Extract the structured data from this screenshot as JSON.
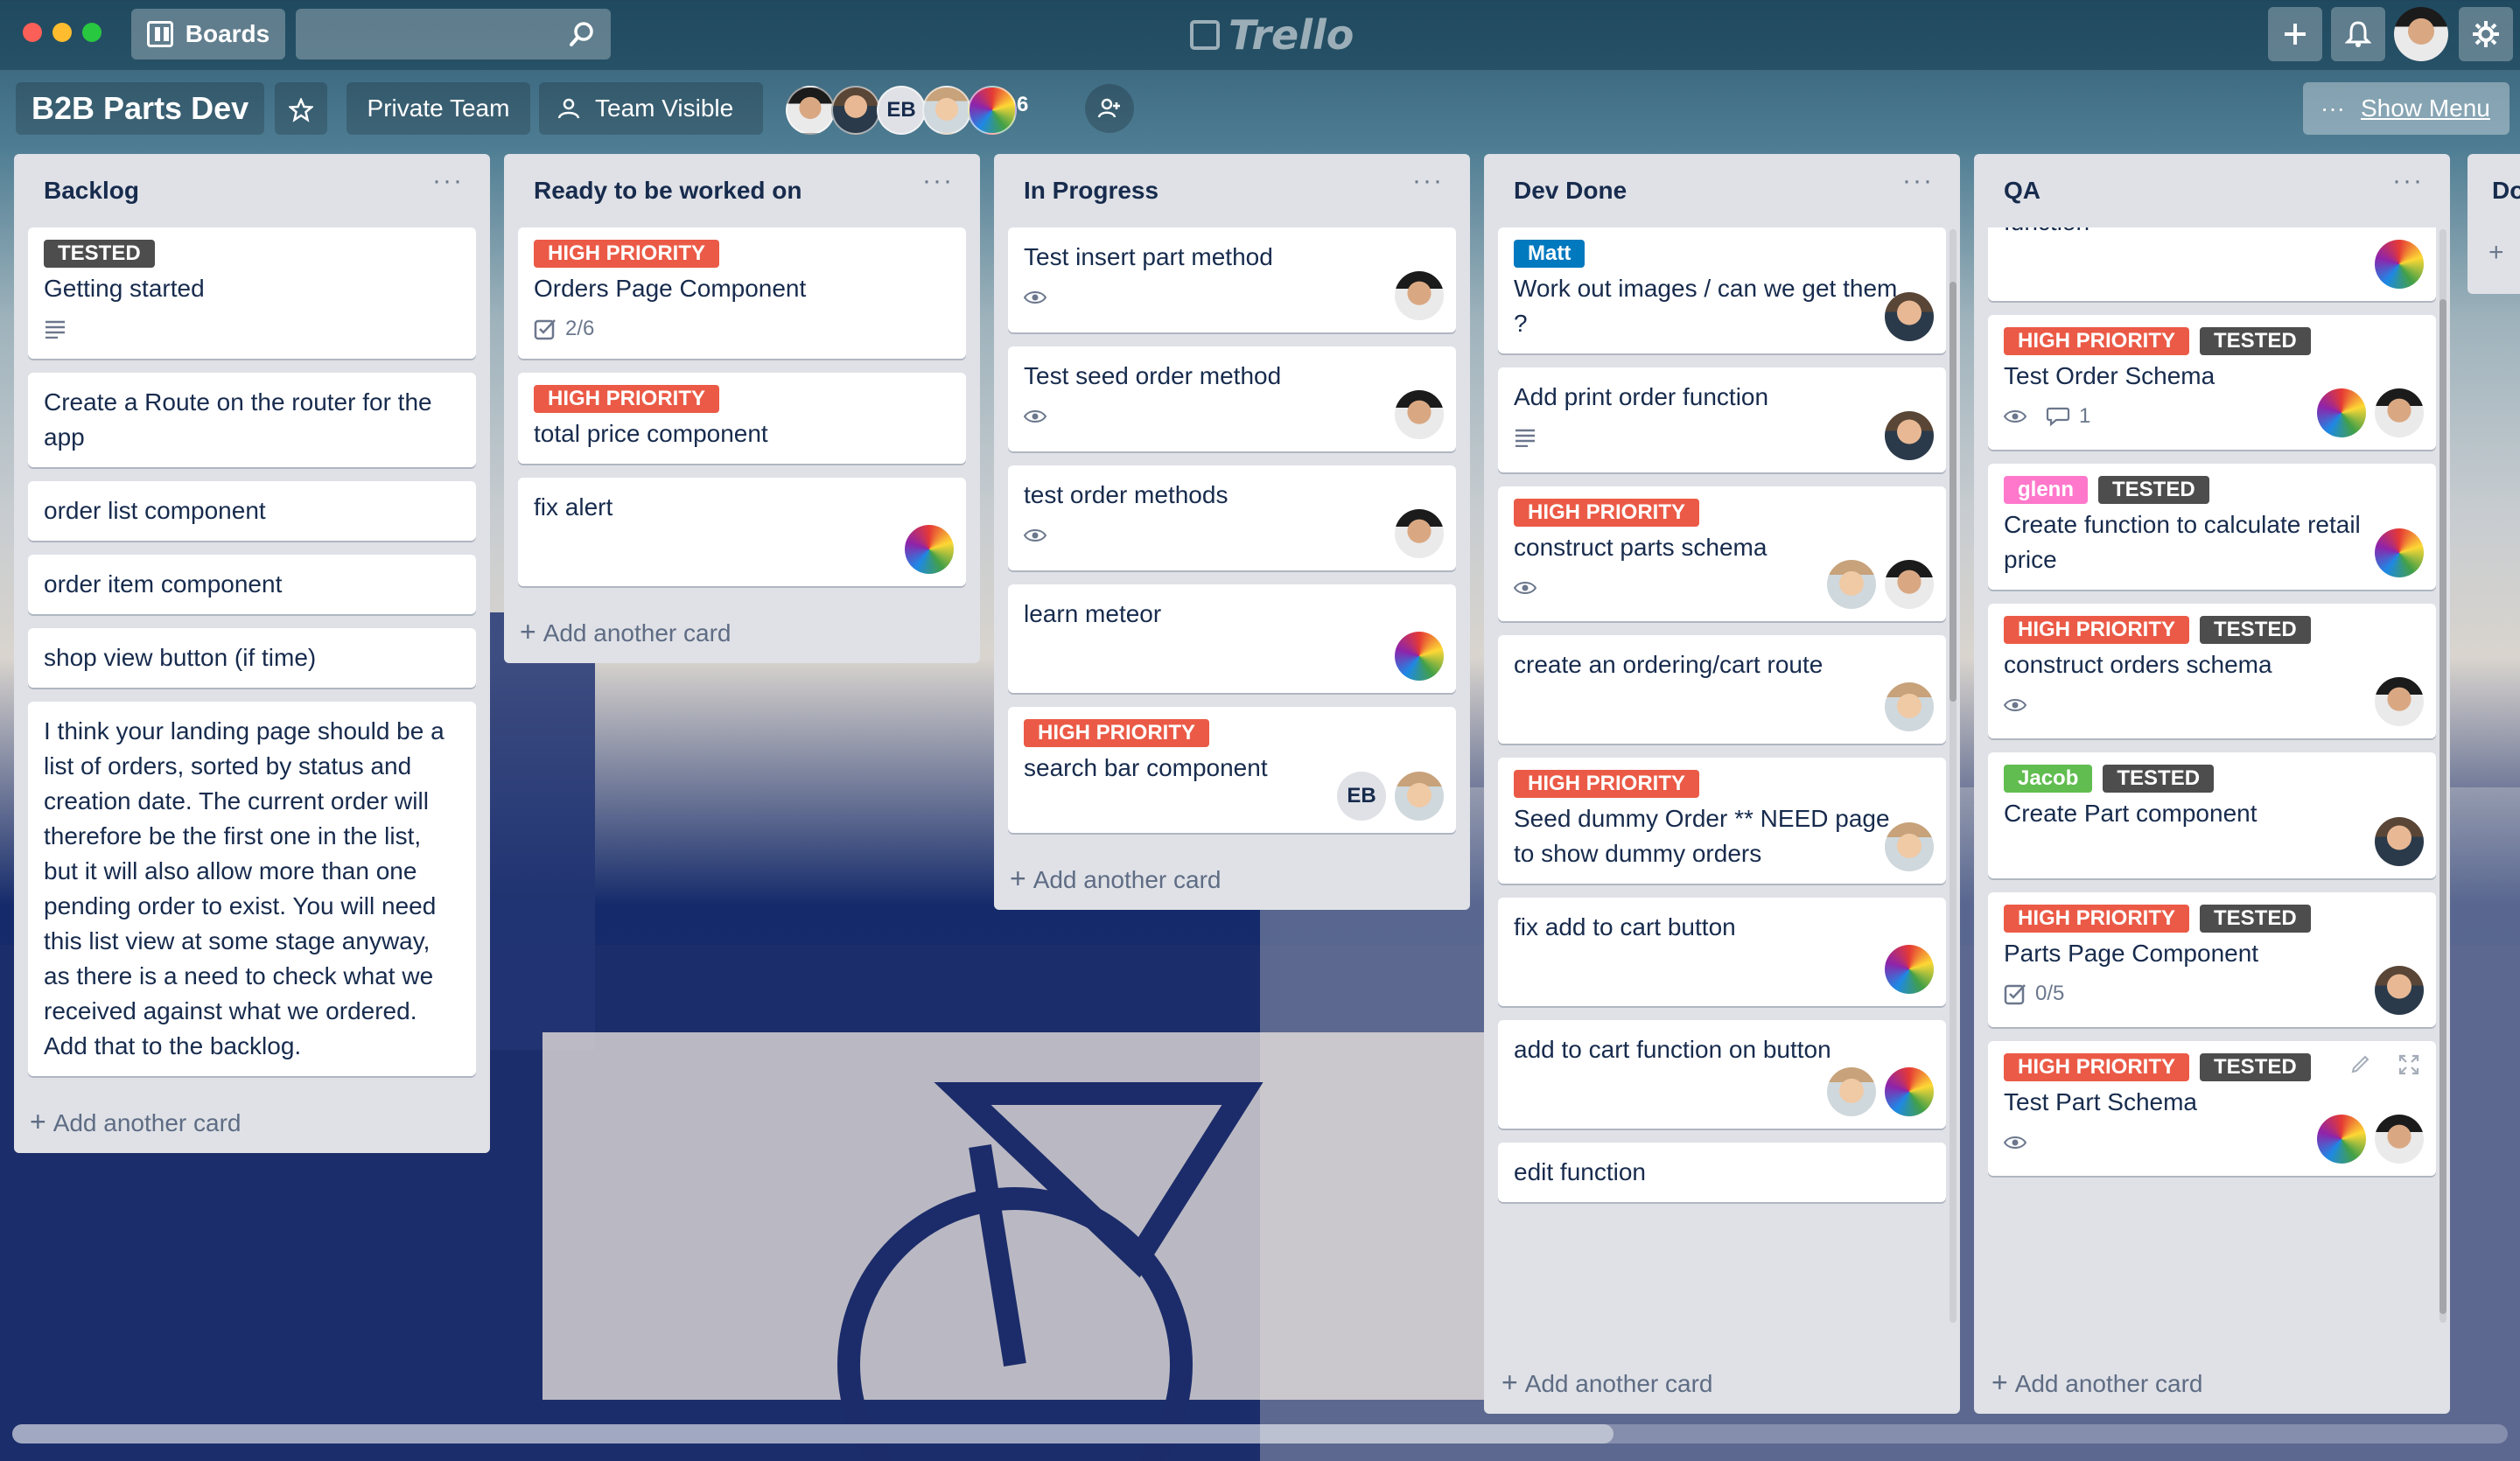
{
  "header": {
    "boards_label": "Boards",
    "search_placeholder": "",
    "logo_text": "Trello",
    "icons": [
      "boards-icon",
      "search-icon",
      "plus-icon",
      "bell-icon",
      "gear-icon"
    ]
  },
  "board": {
    "title": "B2B Parts Dev",
    "team_label": "Private Team",
    "visibility_label": "Team Visible",
    "member_initials": "EB",
    "member_count": "6",
    "show_menu_dots": "···",
    "show_menu_label": "Show Menu"
  },
  "colors": {
    "high_priority": "#eb5a46",
    "tested": "#4d4d4d",
    "matt": "#0079bf",
    "glenn": "#ff78cb",
    "jacob": "#61bd4f"
  },
  "lists": [
    {
      "title": "Backlog",
      "menu": "···",
      "add_label": "Add another card",
      "cards": [
        {
          "labels": [
            {
              "text": "TESTED",
              "color": "#4d4d4d"
            }
          ],
          "title": "Getting started",
          "badges": {
            "description": true
          },
          "avatars": []
        },
        {
          "labels": [],
          "title": "Create a Route on the router for the app",
          "badges": {},
          "avatars": []
        },
        {
          "labels": [],
          "title": "order list component",
          "badges": {},
          "avatars": []
        },
        {
          "labels": [],
          "title": "order item component",
          "badges": {},
          "avatars": []
        },
        {
          "labels": [],
          "title": "shop view button (if time)",
          "badges": {},
          "avatars": []
        },
        {
          "labels": [],
          "title": "I think your landing page should be a list of orders, sorted by status and creation date. The current order will therefore be the first one in the list, but it will also allow more than one pending order to exist. You will need this list view at some stage anyway, as there is a need to check what we received against what we ordered. Add that to the backlog.",
          "badges": {},
          "avatars": []
        }
      ]
    },
    {
      "title": "Ready to be worked on",
      "menu": "···",
      "add_label": "Add another card",
      "cards": [
        {
          "labels": [
            {
              "text": "HIGH PRIORITY",
              "color": "#eb5a46"
            }
          ],
          "title": "Orders Page Component",
          "badges": {
            "checklist": "2/6"
          },
          "avatars": []
        },
        {
          "labels": [
            {
              "text": "HIGH PRIORITY",
              "color": "#eb5a46"
            }
          ],
          "title": "total price component",
          "badges": {},
          "avatars": []
        },
        {
          "labels": [],
          "title": "fix alert",
          "badges": {},
          "avatars": [
            "rainbow"
          ]
        }
      ]
    },
    {
      "title": "In Progress",
      "menu": "···",
      "add_label": "Add another card",
      "cards": [
        {
          "labels": [],
          "title": "Test insert part method",
          "badges": {
            "watch": true
          },
          "avatars": [
            "face2"
          ]
        },
        {
          "labels": [],
          "title": "Test seed order method",
          "badges": {
            "watch": true
          },
          "avatars": [
            "face2"
          ]
        },
        {
          "labels": [],
          "title": "test order methods",
          "badges": {
            "watch": true
          },
          "avatars": [
            "face2"
          ]
        },
        {
          "labels": [],
          "title": "learn meteor",
          "badges": {},
          "avatars": [
            "rainbow"
          ]
        },
        {
          "labels": [
            {
              "text": "HIGH PRIORITY",
              "color": "#eb5a46"
            }
          ],
          "title": "search bar component",
          "badges": {},
          "avatars": [
            "EB",
            "face3"
          ]
        }
      ]
    },
    {
      "title": "Dev Done",
      "menu": "···",
      "add_label": "Add another card",
      "cards": [
        {
          "labels": [
            {
              "text": "Matt",
              "color": "#0079bf"
            }
          ],
          "title": "Work out images / can we get them ?",
          "badges": {},
          "avatars": [
            "face"
          ]
        },
        {
          "labels": [],
          "title": "Add print order function",
          "badges": {
            "description": true
          },
          "avatars": [
            "face"
          ]
        },
        {
          "labels": [
            {
              "text": "HIGH PRIORITY",
              "color": "#eb5a46"
            }
          ],
          "title": "construct parts schema",
          "badges": {
            "watch": true
          },
          "avatars": [
            "face3",
            "face2"
          ]
        },
        {
          "labels": [],
          "title": "create an ordering/cart route",
          "badges": {},
          "avatars": [
            "face3"
          ]
        },
        {
          "labels": [
            {
              "text": "HIGH PRIORITY",
              "color": "#eb5a46"
            }
          ],
          "title": "Seed dummy Order ** NEED page to show dummy orders",
          "badges": {},
          "avatars": [
            "face3"
          ]
        },
        {
          "labels": [],
          "title": "fix add to cart button",
          "badges": {},
          "avatars": [
            "rainbow"
          ]
        },
        {
          "labels": [],
          "title": "add to cart function on button",
          "badges": {},
          "avatars": [
            "face3",
            "rainbow"
          ]
        },
        {
          "labels": [],
          "title": "edit function",
          "badges": {},
          "avatars": []
        }
      ]
    },
    {
      "title": "QA",
      "menu": "···",
      "add_label": "Add another card",
      "cards": [
        {
          "labels": [],
          "title": "function",
          "badges": {},
          "avatars": [
            "rainbow"
          ]
        },
        {
          "labels": [
            {
              "text": "HIGH PRIORITY",
              "color": "#eb5a46"
            },
            {
              "text": "TESTED",
              "color": "#4d4d4d"
            }
          ],
          "title": "Test Order Schema",
          "badges": {
            "watch": true,
            "comments": "1"
          },
          "avatars": [
            "rainbow",
            "face2"
          ]
        },
        {
          "labels": [
            {
              "text": "glenn",
              "color": "#ff78cb"
            },
            {
              "text": "TESTED",
              "color": "#4d4d4d"
            }
          ],
          "title": "Create function to calculate retail price",
          "badges": {},
          "avatars": [
            "rainbow"
          ]
        },
        {
          "labels": [
            {
              "text": "HIGH PRIORITY",
              "color": "#eb5a46"
            },
            {
              "text": "TESTED",
              "color": "#4d4d4d"
            }
          ],
          "title": "construct orders schema",
          "badges": {
            "watch": true
          },
          "avatars": [
            "face2"
          ]
        },
        {
          "labels": [
            {
              "text": "Jacob",
              "color": "#61bd4f"
            },
            {
              "text": "TESTED",
              "color": "#4d4d4d"
            }
          ],
          "title": "Create Part component",
          "badges": {},
          "avatars": [
            "face"
          ]
        },
        {
          "labels": [
            {
              "text": "HIGH PRIORITY",
              "color": "#eb5a46"
            },
            {
              "text": "TESTED",
              "color": "#4d4d4d"
            }
          ],
          "title": "Parts Page Component",
          "badges": {
            "checklist": "0/5"
          },
          "avatars": [
            "face"
          ]
        },
        {
          "labels": [
            {
              "text": "HIGH PRIORITY",
              "color": "#eb5a46"
            },
            {
              "text": "TESTED",
              "color": "#4d4d4d"
            }
          ],
          "title": "Test Part Schema",
          "badges": {
            "watch": true
          },
          "avatars": [
            "rainbow",
            "face2"
          ],
          "tools": true
        }
      ]
    }
  ],
  "partial_list": {
    "title": "Do",
    "plus": "+"
  }
}
